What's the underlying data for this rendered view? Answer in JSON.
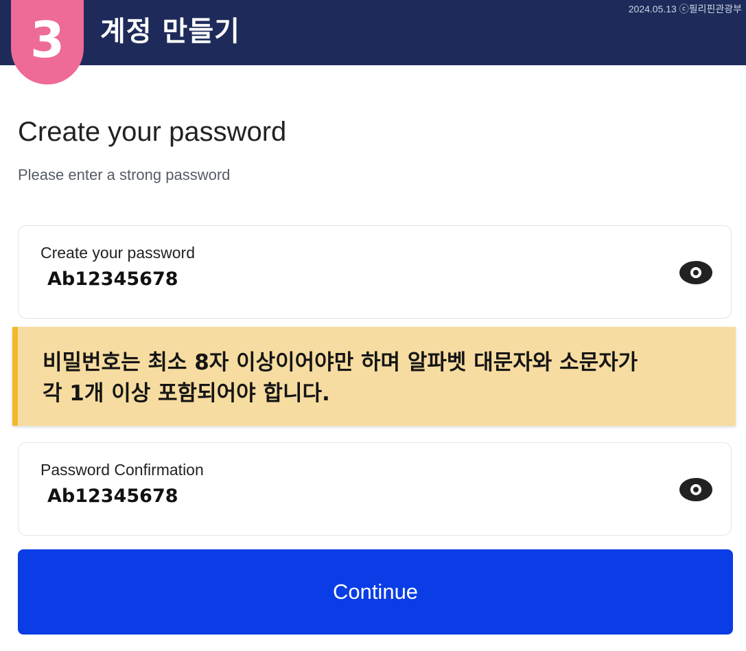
{
  "header": {
    "step_number": "3",
    "title": "계정 만들기",
    "watermark": "2024.05.13 ⓒ필리핀관광부",
    "bg_color": "#1e2b5a",
    "badge_color": "#ee6a97"
  },
  "main": {
    "title": "Create your password",
    "subtitle": "Please enter a strong password"
  },
  "password_field": {
    "label": "Create your password",
    "value": "Ab12345678",
    "icon": "eye-icon"
  },
  "notice": {
    "line1": "비밀번호는 최소 8자 이상이어야만 하며 알파벳 대문자와 소문자가",
    "line2": "각 1개 이상 포함되어야 합니다.",
    "bg_color": "#f6dca0",
    "accent_color": "#f3b72e"
  },
  "confirm_field": {
    "label": "Password Confirmation",
    "value": "Ab12345678",
    "icon": "eye-icon"
  },
  "continue_button": {
    "label": "Continue",
    "color": "#0a3de6"
  }
}
